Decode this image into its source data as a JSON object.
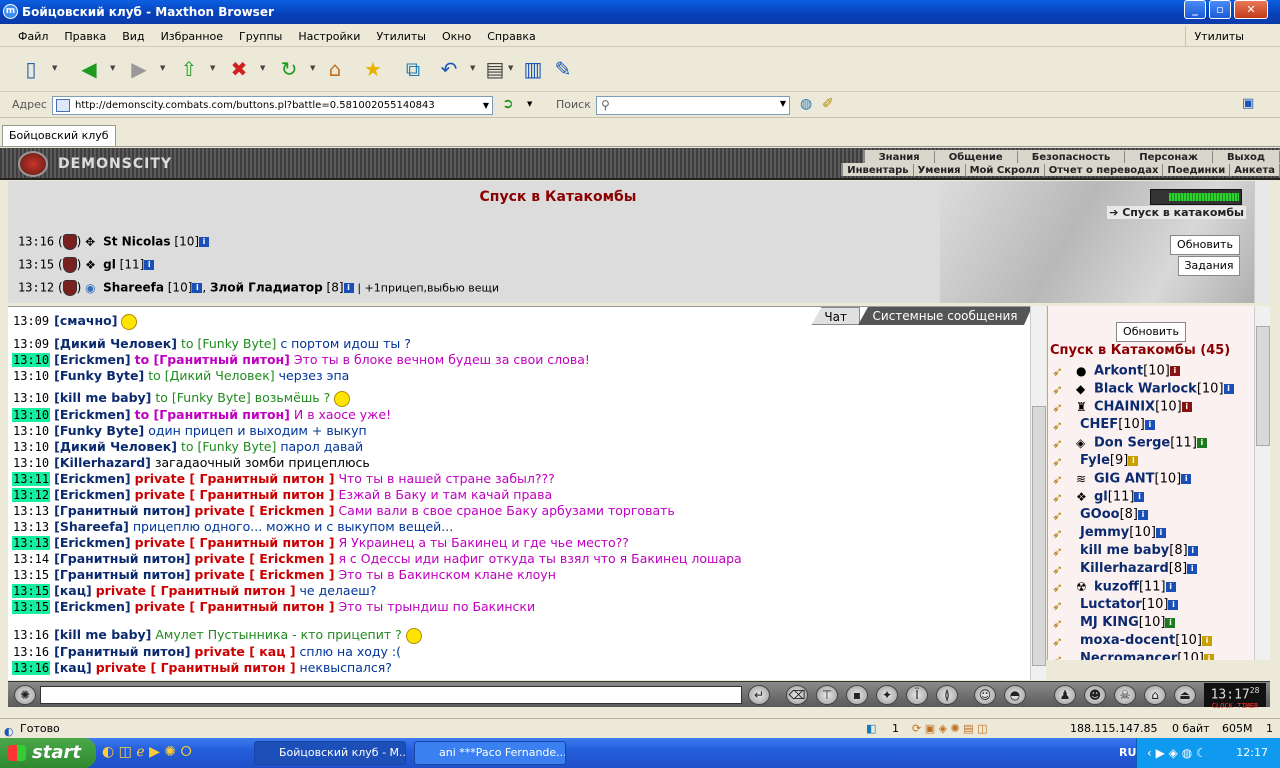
{
  "window": {
    "title": "Бойцовский клуб - Maxthon Browser",
    "app_icon": "maxthon-icon"
  },
  "menu": {
    "items": [
      "Файл",
      "Правка",
      "Вид",
      "Избранное",
      "Группы",
      "Настройки",
      "Утилиты",
      "Окно",
      "Справка"
    ],
    "right": "Утилиты"
  },
  "address": {
    "label": "Адрес",
    "url": "http://demonscity.combats.com/buttons.pl?battle=0.581002055140843",
    "search_label": "Поиск"
  },
  "tabs": [
    {
      "label": "Бойцовский клуб"
    }
  ],
  "game": {
    "logo": "DEMONSCITY",
    "nav_top": [
      "Знания",
      "Общение",
      "Безопасность",
      "Персонаж",
      "Выход"
    ],
    "nav_bottom": [
      "Инвентарь",
      "Умения",
      "Мой Скролл",
      "Отчет о переводах",
      "Поединки",
      "Анкета"
    ]
  },
  "battle": {
    "title": "Спуск в Катакомбы",
    "descend_label": "Спуск в катакомбы",
    "refresh": "Обновить",
    "tasks": "Задания",
    "log": [
      {
        "time": "13:16",
        "name": "St Nicolas",
        "level": "[10]",
        "extra": ""
      },
      {
        "time": "13:15",
        "name": "gl",
        "level": "[11]",
        "extra": ""
      },
      {
        "time": "13:12",
        "name": "Shareefa",
        "level": "[10]",
        "name2": "Злой Гладиатор",
        "level2": "[8]",
        "extra": "| +1прицеп,выбью вещи"
      }
    ]
  },
  "chat": {
    "tab_chat": "Чат",
    "tab_system": "Системные сообщения",
    "lines": [
      {
        "time": "13:09",
        "hl": false,
        "nick": "[смачно]",
        "kind": "",
        "target": "",
        "text": "",
        "smile": true
      },
      {
        "time": "13:09",
        "hl": false,
        "nick": "[Дикий Человек]",
        "kind": "to",
        "target": "to [Funky Byte]",
        "text": "с портом идош ты ?",
        "style": "bl"
      },
      {
        "time": "13:10",
        "hl": true,
        "nick": "[Erickmen]",
        "kind": "tom",
        "target": "to [Гранитный питон]",
        "text": "Это ты в блоке вечном будеш за свои слова!",
        "style": "mg"
      },
      {
        "time": "13:10",
        "hl": false,
        "nick": "[Funky Byte]",
        "kind": "to",
        "target": "to [Дикий Человек]",
        "text": "черзез эпа",
        "style": "bl"
      },
      {
        "time": "13:10",
        "hl": false,
        "nick": "[kill me baby]",
        "kind": "to",
        "target": "to [Funky Byte]",
        "text": "возьмёшь ?",
        "style": "gr",
        "smile": true
      },
      {
        "time": "13:10",
        "hl": true,
        "nick": "[Erickmen]",
        "kind": "tom",
        "target": "to [Гранитный питон]",
        "text": "И в хаосе уже!",
        "style": "mg"
      },
      {
        "time": "13:10",
        "hl": false,
        "nick": "[Funky Byte]",
        "kind": "",
        "target": "",
        "text": "один прицеп и выходим + выкуп",
        "style": "bl"
      },
      {
        "time": "13:10",
        "hl": false,
        "nick": "[Дикий Человек]",
        "kind": "to",
        "target": "to [Funky Byte]",
        "text": "парол давай",
        "style": "bl"
      },
      {
        "time": "13:10",
        "hl": false,
        "nick": "[Killerhazard]",
        "kind": "",
        "target": "",
        "text": "загадаочный зомби прицеплюсь",
        "style": ""
      },
      {
        "time": "13:11",
        "hl": true,
        "nick": "[Erickmen]",
        "kind": "pv",
        "target": "private [ Гранитный питон ]",
        "text": "Что ты в нашей стране забыл???",
        "style": "mg"
      },
      {
        "time": "13:12",
        "hl": true,
        "nick": "[Erickmen]",
        "kind": "pv",
        "target": "private [ Гранитный питон ]",
        "text": "Езжай в Баку и там качай права",
        "style": "mg"
      },
      {
        "time": "13:13",
        "hl": false,
        "nick": "[Гранитный питон]",
        "kind": "pv",
        "target": "private [ Erickmen ]",
        "text": "Сами вали в свое сраное Баку арбузами торговать",
        "style": "mg"
      },
      {
        "time": "13:13",
        "hl": false,
        "nick": "[Shareefa]",
        "kind": "",
        "target": "",
        "text": "прицеплю одного... можно и с выкупом вещей...",
        "style": "bl"
      },
      {
        "time": "13:13",
        "hl": true,
        "nick": "[Erickmen]",
        "kind": "pv",
        "target": "private [ Гранитный питон ]",
        "text": "Я Украинец а ты Бакинец и где чье место??",
        "style": "mg"
      },
      {
        "time": "13:14",
        "hl": false,
        "nick": "[Гранитный питон]",
        "kind": "pv",
        "target": "private [ Erickmen ]",
        "text": "я с Одессы иди нафиг откуда ты взял что я Бакинец лошара",
        "style": "mg"
      },
      {
        "time": "13:15",
        "hl": false,
        "nick": "[Гранитный питон]",
        "kind": "pv",
        "target": "private [ Erickmen ]",
        "text": "Это ты в Бакинском клане клоун",
        "style": "mg"
      },
      {
        "time": "13:15",
        "hl": true,
        "nick": "[кац]",
        "kind": "pv",
        "target": "private [ Гранитный питон ]",
        "text": "че делаеш?",
        "style": "bl"
      },
      {
        "time": "13:15",
        "hl": true,
        "nick": "[Erickmen]",
        "kind": "pv",
        "target": "private [ Гранитный питон ]",
        "text": "Это ты трындиш по Бакински",
        "style": "mg"
      },
      {
        "time": "13:16",
        "hl": false,
        "nick": "[kill me baby]",
        "kind": "",
        "target": "",
        "text": "Амулет Пустынника - кто прицепит ?",
        "style": "gr",
        "smile": true
      },
      {
        "time": "13:16",
        "hl": false,
        "nick": "[Гранитный питон]",
        "kind": "pv",
        "target": "private [ кац ]",
        "text": "сплю на ходу :(",
        "style": "bl"
      },
      {
        "time": "13:16",
        "hl": true,
        "nick": "[кац]",
        "kind": "pv",
        "target": "private [ Гранитный питон ]",
        "text": "неквыспался?",
        "style": "bl"
      }
    ]
  },
  "users": {
    "refresh": "Обновить",
    "title": "Спуск в Катакомбы (45)",
    "list": [
      {
        "name": "Arkont",
        "level": "[10]",
        "ib": "r",
        "ava": "●"
      },
      {
        "name": "Black Warlock",
        "level": "[10]",
        "ib": "b",
        "ava": "◆"
      },
      {
        "name": "CHAINIX",
        "level": "[10]",
        "ib": "r",
        "ava": "♜"
      },
      {
        "name": "CHEF",
        "level": "[10]",
        "ib": "b",
        "ava": ""
      },
      {
        "name": "Don Serge",
        "level": "[11]",
        "ib": "g",
        "ava": "◈"
      },
      {
        "name": "Fyle",
        "level": "[9]",
        "ib": "y",
        "ava": ""
      },
      {
        "name": "GIG ANT",
        "level": "[10]",
        "ib": "b",
        "ava": "≋"
      },
      {
        "name": "gl",
        "level": "[11]",
        "ib": "b",
        "ava": "❖"
      },
      {
        "name": "GOoo",
        "level": "[8]",
        "ib": "b",
        "ava": ""
      },
      {
        "name": "Jemmy",
        "level": "[10]",
        "ib": "b",
        "ava": ""
      },
      {
        "name": "kill me baby",
        "level": "[8]",
        "ib": "b",
        "ava": ""
      },
      {
        "name": "Killerhazard",
        "level": "[8]",
        "ib": "b",
        "ava": ""
      },
      {
        "name": "kuzoff",
        "level": "[11]",
        "ib": "b",
        "ava": "☢"
      },
      {
        "name": "Luctator",
        "level": "[10]",
        "ib": "b",
        "ava": ""
      },
      {
        "name": "MJ KING",
        "level": "[10]",
        "ib": "g",
        "ava": ""
      },
      {
        "name": "moxa-docent",
        "level": "[10]",
        "ib": "y",
        "ava": ""
      },
      {
        "name": "Necromancer",
        "level": "[10]",
        "ib": "y",
        "ava": ""
      }
    ]
  },
  "clock": {
    "time": "13:17",
    "sec": "28",
    "labels": "CLOCK TIMER"
  },
  "status": {
    "text": "Готово",
    "count": "1",
    "ip": "188.115.147.85",
    "traffic": "0 байт",
    "memory": "605M",
    "tabs": "1"
  },
  "taskbar": {
    "start": "start",
    "tasks": [
      "Бойцовский клуб - M...",
      "ani ***Paco Fernande..."
    ],
    "lang": "RU",
    "time": "12:17"
  },
  "colors": {
    "title_blue": "#0a5fe0",
    "hl_time": "#14f0a0",
    "private_red": "#cc0000",
    "magenta": "#c000c0",
    "nick_blue": "#0c2a6e"
  }
}
